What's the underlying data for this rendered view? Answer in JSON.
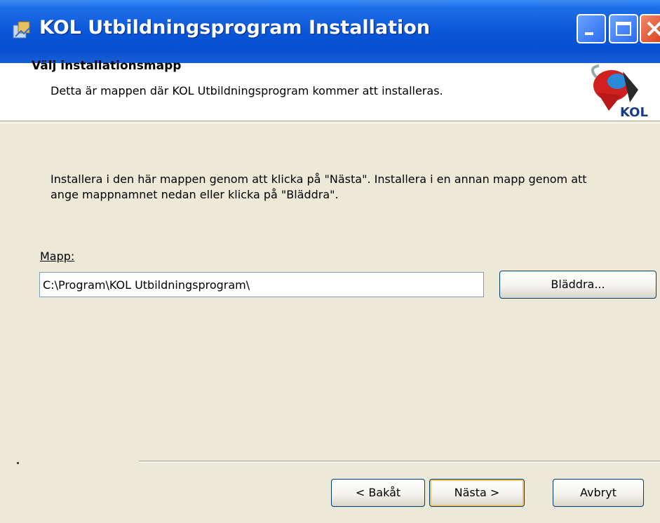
{
  "window": {
    "title": "KOL Utbildningsprogram Installation"
  },
  "header": {
    "title": "Välj installationsmapp",
    "subtitle": "Detta är mappen där KOL Utbildningsprogram kommer att installeras.",
    "logo_text": "KOL"
  },
  "body": {
    "description": "Installera i den här mappen genom att klicka på \"Nästa\". Installera i en annan mapp genom att ange mappnamnet nedan eller klicka på \"Bläddra\".",
    "folder_label": "Mapp:",
    "folder_path": "C:\\Program\\KOL Utbildningsprogram\\",
    "browse_label": "Bläddra..."
  },
  "footer": {
    "back_label": "< Bakåt",
    "next_label": "Nästa >",
    "cancel_label": "Avbryt"
  },
  "colors": {
    "titlebar": "#0a56d8",
    "dialog_bg": "#ece9d8",
    "header_bg": "#ffffff",
    "default_button_focus": "#f4c46a"
  },
  "icons": {
    "app": "installer-icon",
    "minimize": "minimize-icon",
    "maximize": "maximize-icon",
    "close": "close-icon",
    "logo": "kol-logo"
  }
}
